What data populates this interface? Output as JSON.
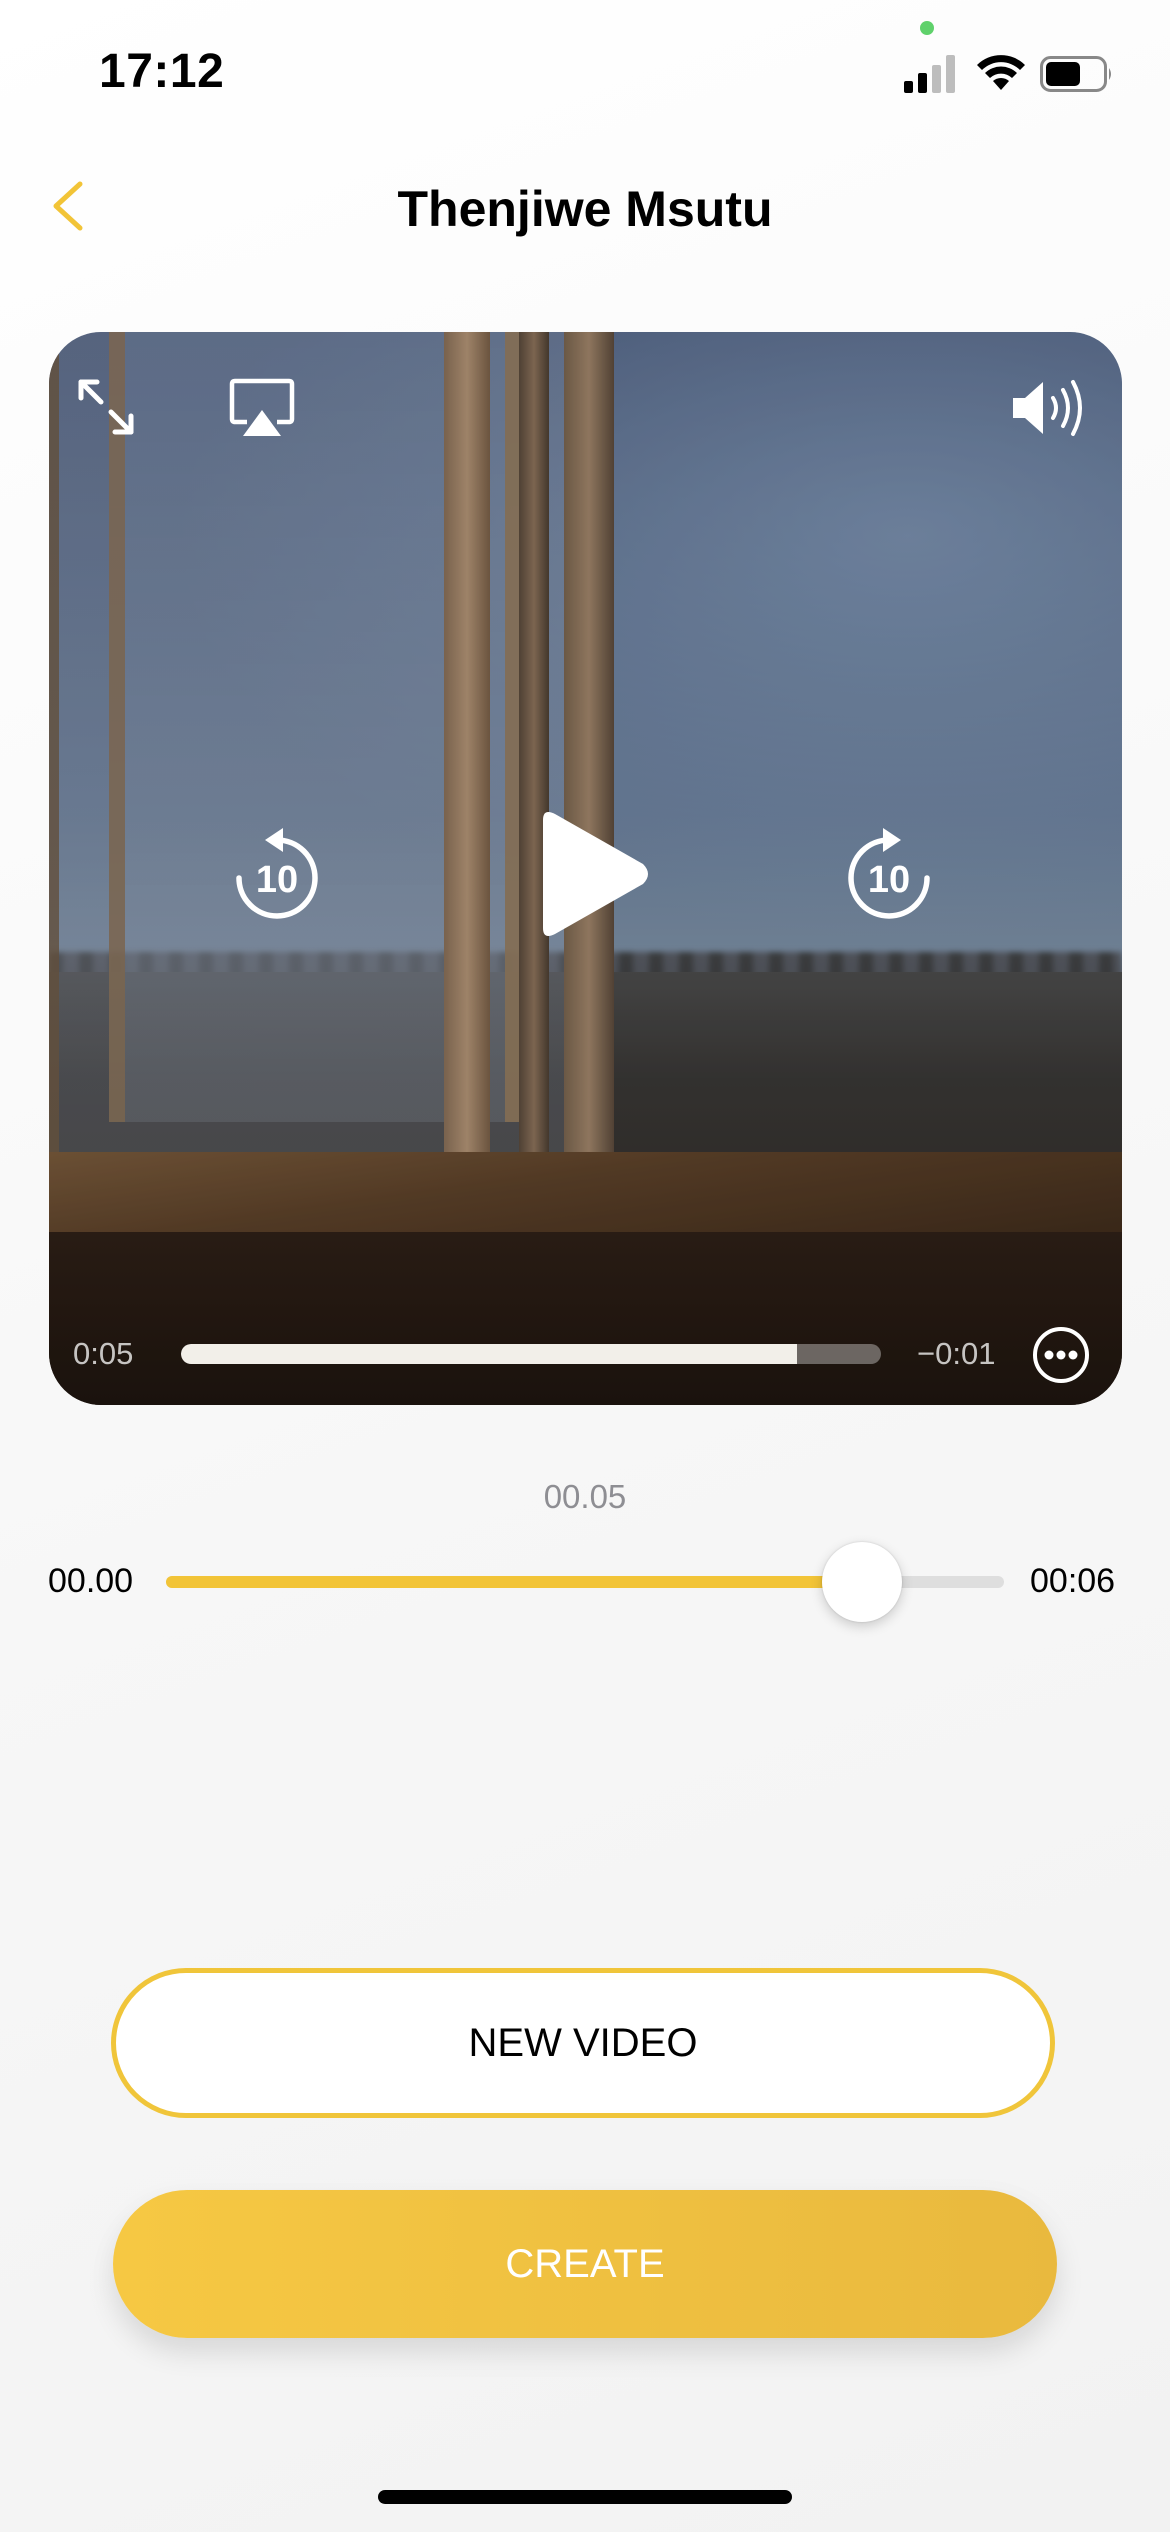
{
  "status_bar": {
    "time": "17:12"
  },
  "nav": {
    "title": "Thenjiwe Msutu"
  },
  "player": {
    "elapsed": "0:05",
    "remaining": "−0:01",
    "progress": 0.88,
    "skip_back_seconds": "10",
    "skip_forward_seconds": "10",
    "icons": [
      "fullscreen-icon",
      "airplay-icon",
      "volume-icon",
      "skip-back-10-icon",
      "play-icon",
      "skip-forward-10-icon",
      "more-icon"
    ]
  },
  "trim": {
    "current": "00.05",
    "start": "00.00",
    "end": "00:06",
    "value_fraction": 0.83
  },
  "buttons": {
    "new_video": "NEW VIDEO",
    "create": "CREATE"
  },
  "colors": {
    "accent": "#f2c437",
    "button_text_light": "#ffffff"
  }
}
